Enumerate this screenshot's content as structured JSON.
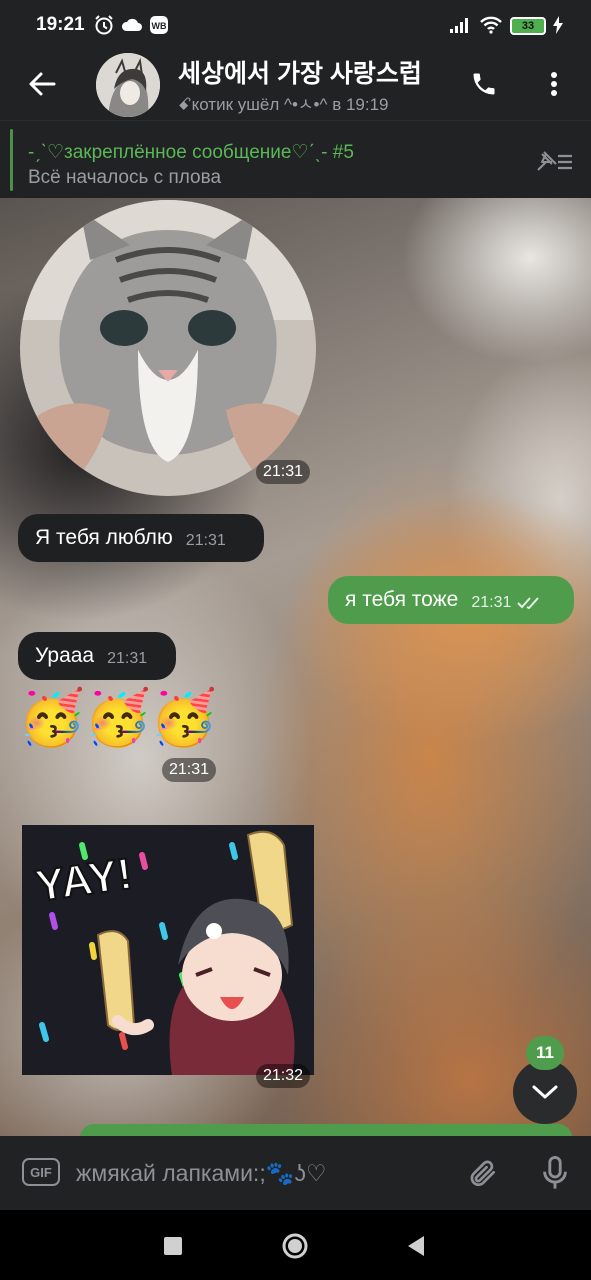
{
  "status_bar": {
    "time": "19:21",
    "icons": [
      "alarm-icon",
      "cloud-icon",
      "wb-icon",
      "signal-icon",
      "wifi-icon",
      "battery-icon",
      "charging-icon"
    ],
    "battery_level": "33"
  },
  "header": {
    "title": "세상에서 가장 사랑스럽",
    "status": "ꗃкотик ушёл ^•ㅅ•^ в 19:19",
    "icons": [
      "back-arrow-icon",
      "avatar-image",
      "phone-icon",
      "more-vertical-icon"
    ]
  },
  "pinned": {
    "title": "-ˏˋ♡закреплённое сообщение♡ˊˎ- #5",
    "text": "Всё началось с плова",
    "icon": "unpin-list-icon"
  },
  "messages": {
    "video": {
      "type": "video-note",
      "time": "21:31"
    },
    "m1": {
      "text": "Я тебя люблю",
      "time": "21:31",
      "direction": "incoming"
    },
    "m2": {
      "text": "я тебя тоже",
      "time": "21:31",
      "direction": "outgoing",
      "status": "read"
    },
    "m3": {
      "text": "Урааа",
      "time": "21:31",
      "direction": "incoming"
    },
    "m4": {
      "emojis": [
        "🥳",
        "🥳",
        "🥳"
      ],
      "time": "21:31",
      "direction": "incoming"
    },
    "m5": {
      "type": "sticker",
      "sticker_text": "YAY!",
      "time": "21:32",
      "direction": "incoming"
    }
  },
  "scroll_down": {
    "unread_count": "11",
    "icon": "chevron-down-icon"
  },
  "input": {
    "gif_label": "GIF",
    "placeholder": "жмякай лапками:;🐾ʖ♡",
    "icons": [
      "attach-icon",
      "microphone-icon"
    ]
  },
  "nav_bar": {
    "icons": [
      "recents-square-icon",
      "home-circle-icon",
      "back-triangle-icon"
    ]
  },
  "colors": {
    "accent": "#4f9d4c",
    "bubble_in": "#1f2021",
    "bar_bg": "#212223",
    "pinned_title": "#5bb757"
  }
}
